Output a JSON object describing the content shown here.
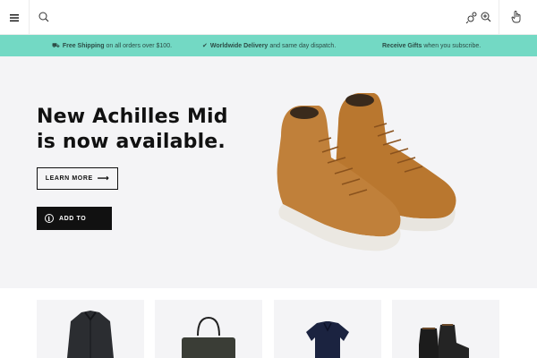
{
  "header": {
    "menu_icon": "hamburger-menu-icon",
    "search_icon": "search-icon",
    "tool_icons": [
      "gear-icon",
      "zoom-icon"
    ],
    "touch_icon": "hand-pointer-icon"
  },
  "promo": {
    "background": "#73d9c4",
    "items": [
      {
        "icon": "truck-icon",
        "strong": "Free Shipping",
        "text": "on all orders over $100."
      },
      {
        "icon": "check-icon",
        "strong": "Worldwide Delivery",
        "text": "and same day dispatch."
      },
      {
        "icon": "",
        "strong": "Receive Gifts",
        "text": "when you subscribe."
      }
    ]
  },
  "hero": {
    "title_line1": "New Achilles Mid",
    "title_line2": "is now available.",
    "learn_more_label": "LEARN MORE",
    "add_to_label": "ADD TO",
    "image": "tan-suede-sneakers"
  },
  "products": [
    {
      "image": "dark-coat"
    },
    {
      "image": "dark-bag"
    },
    {
      "image": "navy-polo-shirt"
    },
    {
      "image": "black-boots"
    }
  ]
}
